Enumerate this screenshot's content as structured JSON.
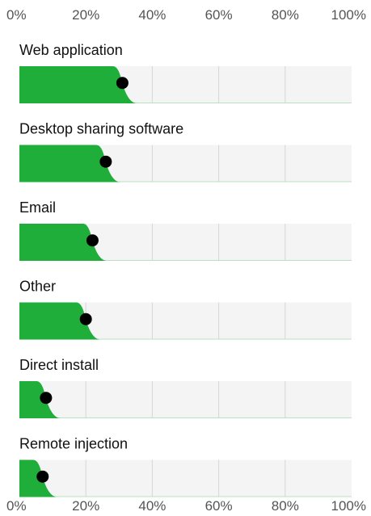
{
  "chart_data": {
    "type": "bar",
    "orientation": "horizontal",
    "title": "",
    "xlabel": "",
    "ylabel": "",
    "xlim": [
      0,
      100
    ],
    "x_ticks": [
      "0%",
      "20%",
      "40%",
      "60%",
      "80%",
      "100%"
    ],
    "x_tick_values": [
      0,
      20,
      40,
      60,
      80,
      100
    ],
    "tick_position": "top and bottom",
    "grid": true,
    "legend": "none",
    "categories": [
      "Web application",
      "Desktop sharing software",
      "Email",
      "Other",
      "Direct install",
      "Remote injection"
    ],
    "values": [
      31,
      26,
      22,
      20,
      8,
      7
    ],
    "colors": {
      "bar": "#1fae3a",
      "track": "#f4f4f4",
      "grid": "#d6d6d6",
      "marker": "#000000",
      "baseline": "#b9e2c2"
    }
  }
}
